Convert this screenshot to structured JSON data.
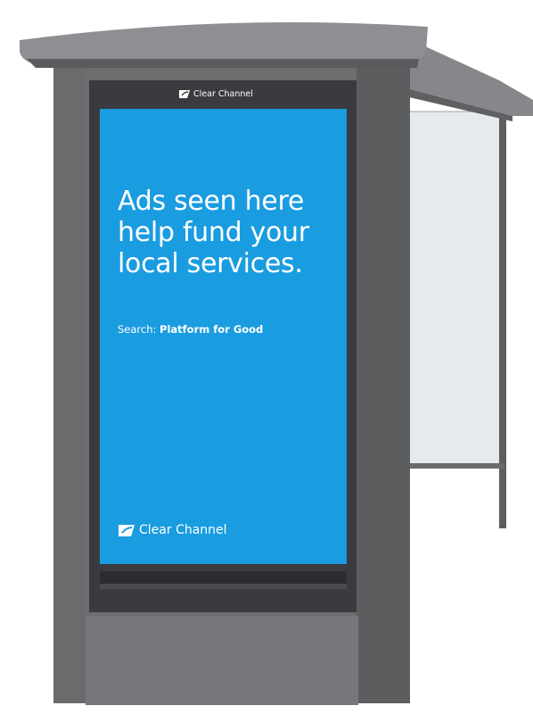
{
  "ad": {
    "headline_line1": "Ads seen here",
    "headline_line2": "help fund your",
    "headline_line3": "local services.",
    "search_prefix": "Search:",
    "search_term": "Platform for Good",
    "brand_bottom": "Clear Channel",
    "brand_top": "Clear Channel",
    "background_color": "#1a9ce0",
    "text_color": "#ffffff"
  },
  "structure": {
    "frame_color": "#6e6e70",
    "roof_color": "#8a8a8c",
    "glass_color": "#e6eaed"
  },
  "icons": {
    "brand_logo": "clear-channel-logo-icon"
  }
}
